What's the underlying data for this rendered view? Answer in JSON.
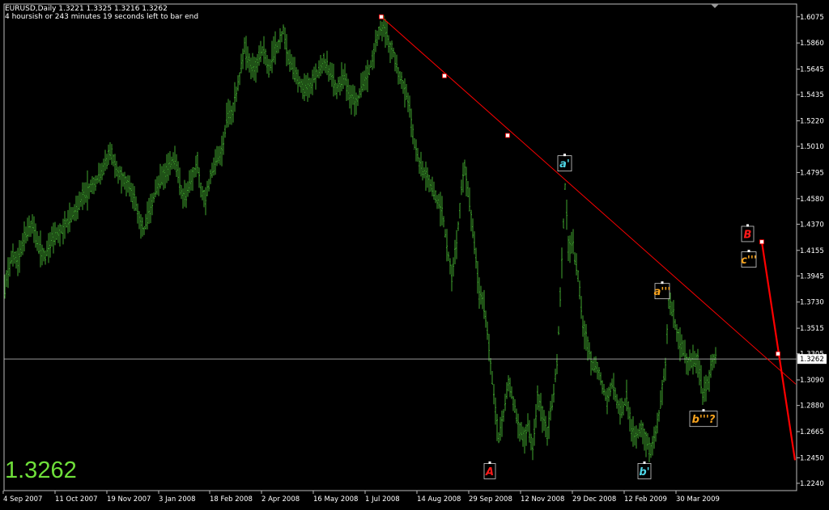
{
  "header": {
    "symbol_line": "EURUSD,Daily  1.3221 1.3325 1.3216 1.3262",
    "timer_line": "4 hoursish or 243 minutes 19 seconds left to bar end"
  },
  "big_price": "1.3262",
  "colors": {
    "background": "#000000",
    "candle": "#3fa32e",
    "trendline": "#ff0000",
    "price_line": "#c8c8c8",
    "axis_text": "#ffffff",
    "label_cyan": "#4fd6e6",
    "label_orange": "#f7a31e",
    "label_red": "#ff1a1a",
    "big_price": "#6fe03a"
  },
  "chart_data": {
    "type": "bar",
    "title": "EURUSD,Daily  1.3221 1.3325 1.3216 1.3262",
    "ylim": [
      1.218,
      1.618
    ],
    "y_ticks": [
      "1.6075",
      "1.5860",
      "1.5645",
      "1.5435",
      "1.5220",
      "1.5010",
      "1.4795",
      "1.4580",
      "1.4370",
      "1.4155",
      "1.3945",
      "1.3730",
      "1.3515",
      "1.3305",
      "1.3090",
      "1.2880",
      "1.2665",
      "1.2450",
      "1.2240"
    ],
    "current_price": "1.3262",
    "x_ticks": [
      "4 Sep 2007",
      "11 Oct 2007",
      "19 Nov 2007",
      "3 Jan 2008",
      "18 Feb 2008",
      "2 Apr 2008",
      "16 May 2008",
      "1 Jul 2008",
      "14 Aug 2008",
      "29 Sep 2008",
      "12 Nov 2008",
      "29 Dec 2008",
      "12 Feb 2009",
      "30 Mar 2009"
    ],
    "series": [
      {
        "ohlc_path": [
          [
            0,
            1.352
          ],
          [
            8,
            1.393
          ],
          [
            16,
            1.412
          ],
          [
            22,
            1.405
          ],
          [
            30,
            1.428
          ],
          [
            40,
            1.437
          ],
          [
            48,
            1.418
          ],
          [
            56,
            1.411
          ],
          [
            64,
            1.425
          ],
          [
            74,
            1.431
          ],
          [
            82,
            1.437
          ],
          [
            92,
            1.446
          ],
          [
            102,
            1.46
          ],
          [
            110,
            1.466
          ],
          [
            118,
            1.473
          ],
          [
            128,
            1.481
          ],
          [
            136,
            1.498
          ],
          [
            144,
            1.481
          ],
          [
            150,
            1.477
          ],
          [
            158,
            1.47
          ],
          [
            166,
            1.456
          ],
          [
            172,
            1.443
          ],
          [
            178,
            1.432
          ],
          [
            186,
            1.451
          ],
          [
            194,
            1.467
          ],
          [
            200,
            1.474
          ],
          [
            208,
            1.483
          ],
          [
            214,
            1.491
          ],
          [
            220,
            1.478
          ],
          [
            226,
            1.457
          ],
          [
            232,
            1.465
          ],
          [
            238,
            1.477
          ],
          [
            244,
            1.488
          ],
          [
            248,
            1.467
          ],
          [
            254,
            1.459
          ],
          [
            260,
            1.476
          ],
          [
            266,
            1.488
          ],
          [
            274,
            1.497
          ],
          [
            280,
            1.523
          ],
          [
            288,
            1.532
          ],
          [
            296,
            1.559
          ],
          [
            302,
            1.582
          ],
          [
            308,
            1.569
          ],
          [
            314,
            1.563
          ],
          [
            320,
            1.575
          ],
          [
            326,
            1.583
          ],
          [
            332,
            1.564
          ],
          [
            338,
            1.577
          ],
          [
            344,
            1.585
          ],
          [
            350,
            1.597
          ],
          [
            356,
            1.574
          ],
          [
            362,
            1.563
          ],
          [
            368,
            1.557
          ],
          [
            376,
            1.545
          ],
          [
            384,
            1.553
          ],
          [
            392,
            1.561
          ],
          [
            400,
            1.572
          ],
          [
            408,
            1.561
          ],
          [
            416,
            1.548
          ],
          [
            424,
            1.559
          ],
          [
            432,
            1.544
          ],
          [
            440,
            1.537
          ],
          [
            448,
            1.551
          ],
          [
            456,
            1.563
          ],
          [
            462,
            1.581
          ],
          [
            468,
            1.595
          ],
          [
            474,
            1.598
          ],
          [
            480,
            1.586
          ],
          [
            486,
            1.578
          ],
          [
            492,
            1.562
          ],
          [
            500,
            1.549
          ],
          [
            506,
            1.531
          ],
          [
            512,
            1.503
          ],
          [
            518,
            1.488
          ],
          [
            524,
            1.479
          ],
          [
            530,
            1.473
          ],
          [
            538,
            1.461
          ],
          [
            546,
            1.447
          ],
          [
            552,
            1.42
          ],
          [
            558,
            1.395
          ],
          [
            564,
            1.42
          ],
          [
            570,
            1.466
          ],
          [
            574,
            1.485
          ],
          [
            580,
            1.453
          ],
          [
            586,
            1.42
          ],
          [
            592,
            1.38
          ],
          [
            598,
            1.371
          ],
          [
            604,
            1.335
          ],
          [
            610,
            1.295
          ],
          [
            616,
            1.262
          ],
          [
            622,
            1.281
          ],
          [
            628,
            1.308
          ],
          [
            634,
            1.291
          ],
          [
            640,
            1.272
          ],
          [
            646,
            1.261
          ],
          [
            652,
            1.27
          ],
          [
            658,
            1.253
          ],
          [
            664,
            1.295
          ],
          [
            670,
            1.282
          ],
          [
            676,
            1.265
          ],
          [
            682,
            1.29
          ],
          [
            688,
            1.322
          ],
          [
            694,
            1.405
          ],
          [
            698,
            1.468
          ],
          [
            702,
            1.419
          ],
          [
            708,
            1.418
          ],
          [
            714,
            1.395
          ],
          [
            720,
            1.355
          ],
          [
            726,
            1.338
          ],
          [
            732,
            1.321
          ],
          [
            738,
            1.319
          ],
          [
            744,
            1.304
          ],
          [
            750,
            1.292
          ],
          [
            756,
            1.306
          ],
          [
            762,
            1.292
          ],
          [
            768,
            1.283
          ],
          [
            774,
            1.295
          ],
          [
            780,
            1.269
          ],
          [
            786,
            1.262
          ],
          [
            792,
            1.272
          ],
          [
            798,
            1.26
          ],
          [
            804,
            1.25
          ],
          [
            810,
            1.265
          ],
          [
            816,
            1.29
          ],
          [
            822,
            1.322
          ],
          [
            826,
            1.373
          ],
          [
            832,
            1.362
          ],
          [
            838,
            1.343
          ],
          [
            844,
            1.332
          ],
          [
            850,
            1.321
          ],
          [
            856,
            1.325
          ],
          [
            862,
            1.325
          ],
          [
            868,
            1.298
          ],
          [
            874,
            1.306
          ],
          [
            880,
            1.323
          ],
          [
            884,
            1.329
          ]
        ],
        "values": []
      },
      {
        "trendline": [
          [
            "1 Jul 2008",
            1.6075
          ],
          [
            "future",
            1.243
          ]
        ],
        "values": []
      }
    ],
    "annotations": [
      {
        "text": "a'",
        "color": "cyan",
        "price": 1.487
      },
      {
        "text": "a'''",
        "color": "orange",
        "price": 1.382
      },
      {
        "text": "b'''?",
        "color": "orange",
        "price": 1.277
      },
      {
        "text": "b'",
        "color": "cyan",
        "price": 1.234
      },
      {
        "text": "A",
        "color": "red",
        "price": 1.234
      },
      {
        "text": "B",
        "color": "red",
        "price": 1.429
      },
      {
        "text": "c'''",
        "color": "orange",
        "price": 1.408
      }
    ]
  }
}
